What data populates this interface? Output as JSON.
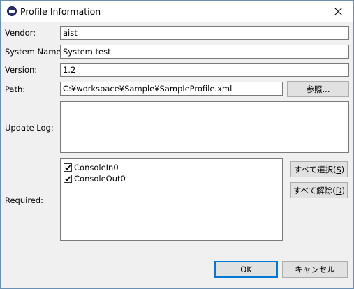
{
  "window": {
    "title": "Profile Information",
    "close_icon": "close-icon",
    "app_icon": "app-icon"
  },
  "fields": {
    "vendor": {
      "label": "Vendor:",
      "value": "aist"
    },
    "system_name": {
      "label": "System Name:",
      "value": "System test"
    },
    "version": {
      "label": "Version:",
      "value": "1.2"
    },
    "path": {
      "label": "Path:",
      "value": "C:¥workspace¥Sample¥SampleProfile.xml",
      "browse_label": "参照..."
    },
    "update_log": {
      "label": "Update Log:",
      "value": ""
    },
    "required": {
      "label": "Required:",
      "items": [
        {
          "label": "ConsoleIn0",
          "checked": true
        },
        {
          "label": "ConsoleOut0",
          "checked": true
        }
      ],
      "select_all_prefix": "すべて選択(",
      "select_all_mnemonic": "S",
      "select_all_suffix": ")",
      "deselect_all_prefix": "すべて解除(",
      "deselect_all_mnemonic": "D",
      "deselect_all_suffix": ")"
    }
  },
  "buttons": {
    "ok": "OK",
    "cancel": "キャンセル"
  }
}
